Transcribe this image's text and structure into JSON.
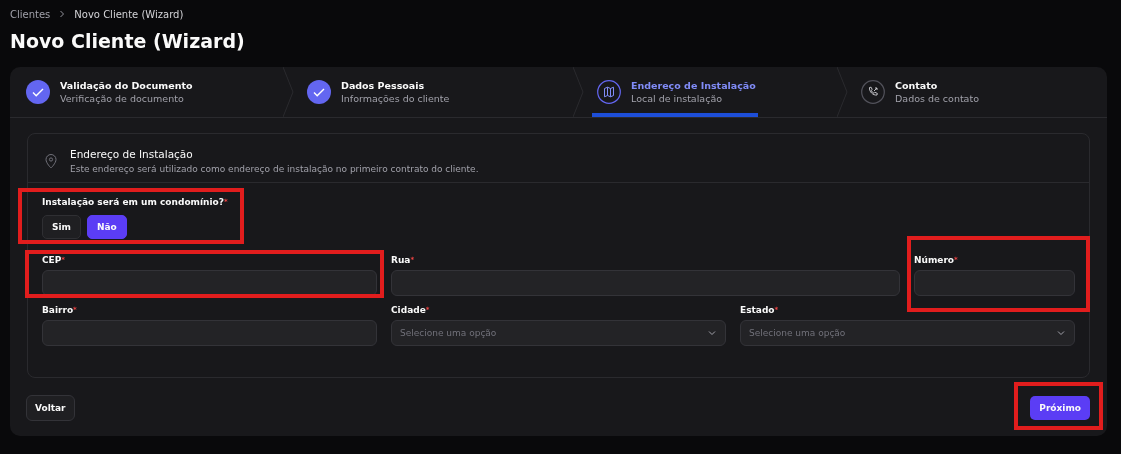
{
  "breadcrumb": [
    "Clientes",
    "Novo Cliente (Wizard)"
  ],
  "title": "Novo Cliente (Wizard)",
  "steps": [
    {
      "title": "Validação do Documento",
      "subtitle": "Verificação de documento",
      "kind": "done",
      "selected": false
    },
    {
      "title": "Dados Pessoais",
      "subtitle": "Informações do cliente",
      "kind": "done",
      "selected": false
    },
    {
      "title": "Endereço de Instalação",
      "subtitle": "Local de instalação",
      "kind": "active",
      "selected": true
    },
    {
      "title": "Contato",
      "subtitle": "Dados de contato",
      "kind": "pending",
      "selected": false
    }
  ],
  "section": {
    "title": "Endereço de Instalação",
    "description": "Este endereço será utilizado como endereço de instalação no primeiro contrato do cliente."
  },
  "condo_question": {
    "label": "Instalação será em um condomínio?",
    "required_mark": "*",
    "highlighted": true,
    "options": [
      {
        "label": "Sim",
        "selected": false
      },
      {
        "label": "Não",
        "selected": true
      }
    ]
  },
  "field_rows": [
    [
      {
        "label": "CEP",
        "required_mark": "*",
        "kind": "text",
        "highlighted": true
      },
      {
        "label": "Rua",
        "required_mark": "*",
        "kind": "text",
        "highlighted": false
      },
      {
        "label": "Número",
        "required_mark": "*",
        "kind": "text",
        "highlighted": true
      }
    ],
    [
      {
        "label": "Bairro",
        "required_mark": "*",
        "kind": "text",
        "highlighted": false
      },
      {
        "label": "Cidade",
        "required_mark": "*",
        "kind": "select",
        "placeholder": "Selecione uma opção",
        "highlighted": false
      },
      {
        "label": "Estado",
        "required_mark": "*",
        "kind": "select",
        "placeholder": "Selecione uma opção",
        "highlighted": false
      }
    ]
  ],
  "back_button": {
    "label": "Voltar"
  },
  "next_button": {
    "label": "Próximo",
    "highlighted": true
  }
}
